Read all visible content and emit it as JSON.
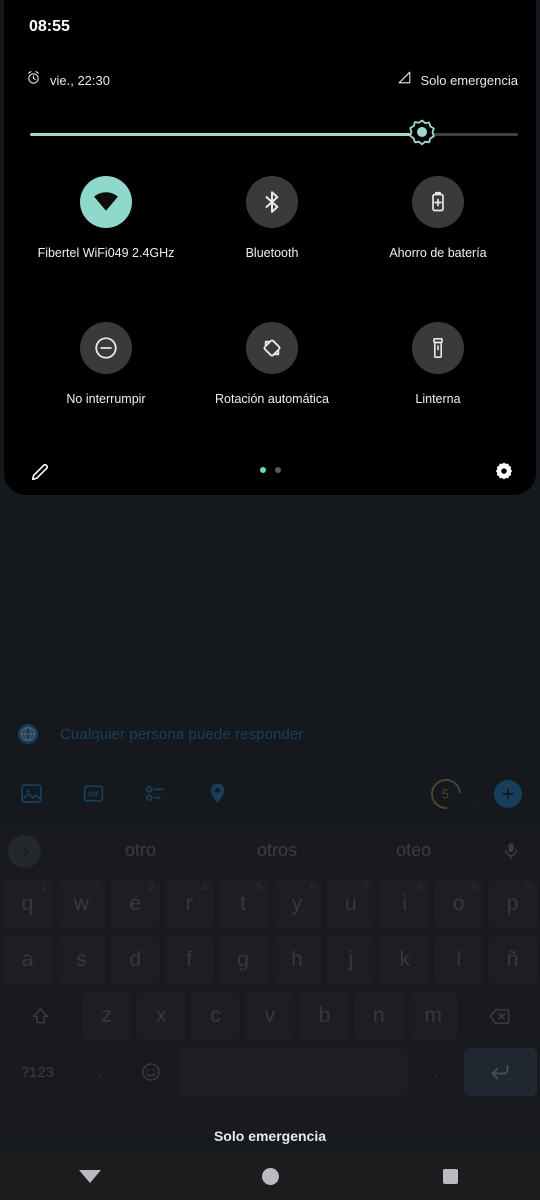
{
  "statusbar": {
    "time": "08:55",
    "alarm_text": "vie., 22:30",
    "alarm_icon": "alarm-clock-icon",
    "signal_text": "Solo emergencia",
    "signal_icon": "signal-no-service-icon"
  },
  "brightness": {
    "icon": "brightness-sun-icon",
    "value_percent": 78,
    "track_color": "#3a4445",
    "fill_color": "#9fd9cf"
  },
  "quick_settings": {
    "accent_color": "#8ed8cc",
    "tiles": [
      {
        "label": "Fibertel WiFi049 2.4GHz",
        "icon": "wifi-icon",
        "state": "on"
      },
      {
        "label": "Bluetooth",
        "icon": "bluetooth-icon",
        "state": "off"
      },
      {
        "label": "Ahorro de batería",
        "icon": "battery-saver-icon",
        "state": "off"
      },
      {
        "label": "No interrumpir",
        "icon": "do-not-disturb-icon",
        "state": "off"
      },
      {
        "label": "Rotación automática",
        "icon": "auto-rotate-icon",
        "state": "off"
      },
      {
        "label": "Linterna",
        "icon": "flashlight-icon",
        "state": "off"
      }
    ],
    "footer": {
      "edit_icon": "pencil-edit-icon",
      "settings_icon": "gear-icon",
      "page_count": 2,
      "active_page": 1
    }
  },
  "compose": {
    "reply_scope": {
      "icon": "globe-icon",
      "label": "Cualquier persona puede responder",
      "color": "#1d9bf0"
    },
    "toolbar": {
      "tools": [
        {
          "icon": "image-icon"
        },
        {
          "icon": "gif-icon"
        },
        {
          "icon": "poll-icon"
        },
        {
          "icon": "location-pin-icon"
        }
      ],
      "char_counter": "5",
      "counter_color": "#c9b458",
      "add_tweet_icon": "plus-icon"
    }
  },
  "keyboard": {
    "suggestions": [
      "otro",
      "otros",
      "oteo"
    ],
    "expand_icon": "chevron-right-icon",
    "mic_icon": "microphone-icon",
    "rows": [
      [
        {
          "label": "q",
          "num": "1"
        },
        {
          "label": "w",
          "num": "2"
        },
        {
          "label": "e",
          "num": "3"
        },
        {
          "label": "r",
          "num": "4"
        },
        {
          "label": "t",
          "num": "5"
        },
        {
          "label": "y",
          "num": "6"
        },
        {
          "label": "u",
          "num": "7"
        },
        {
          "label": "i",
          "num": "8"
        },
        {
          "label": "o",
          "num": "9"
        },
        {
          "label": "p",
          "num": "0"
        }
      ],
      [
        {
          "label": "a"
        },
        {
          "label": "s"
        },
        {
          "label": "d"
        },
        {
          "label": "f"
        },
        {
          "label": "g"
        },
        {
          "label": "h"
        },
        {
          "label": "j"
        },
        {
          "label": "k"
        },
        {
          "label": "l"
        },
        {
          "label": "ñ"
        }
      ],
      [
        {
          "label": "z"
        },
        {
          "label": "x"
        },
        {
          "label": "c"
        },
        {
          "label": "v"
        },
        {
          "label": "b"
        },
        {
          "label": "n"
        },
        {
          "label": "m"
        }
      ]
    ],
    "shift_icon": "shift-arrow-icon",
    "backspace_icon": "backspace-icon",
    "symbols_key": "?123",
    "comma_key": ",",
    "emoji_icon": "emoji-smiley-icon",
    "space_key": "",
    "period_key": ".",
    "enter_icon": "enter-return-icon"
  },
  "emergency_banner": "Solo emergencia",
  "navbar": {
    "back_icon": "triangle-down-back-icon",
    "home_icon": "circle-home-icon",
    "recents_icon": "square-recents-icon"
  }
}
